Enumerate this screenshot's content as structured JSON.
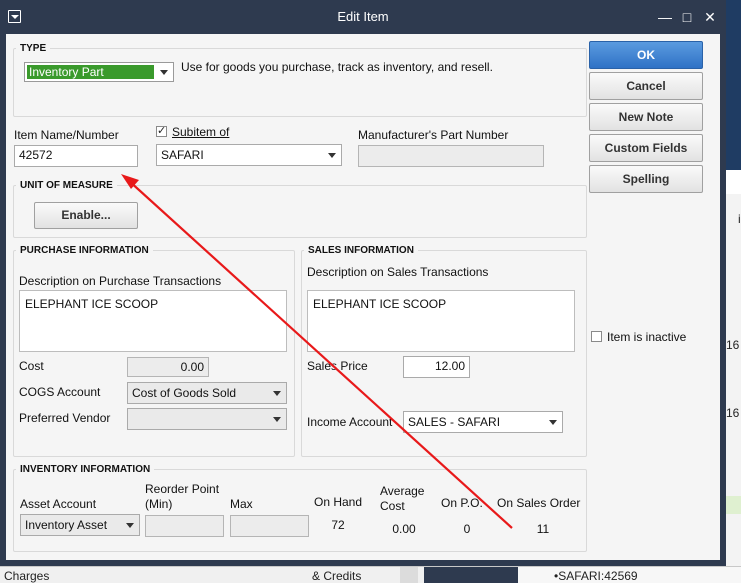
{
  "background": {
    "left_text": "Charges",
    "mid_text": "& Credits",
    "right_item": "•SAFARI:42569",
    "right_digits": [
      "16",
      "16"
    ],
    "right_letter": "i"
  },
  "window": {
    "title": "Edit Item",
    "minimize": "—",
    "maximize": "□",
    "close": "✕"
  },
  "type_section": {
    "legend": "TYPE",
    "selected": "Inventory Part",
    "description": "Use for goods you purchase, track as inventory, and resell."
  },
  "item": {
    "name_label": "Item Name/Number",
    "name_value": "42572",
    "subitem_label": "Subitem of",
    "subitem_checked": true,
    "subitem_value": "SAFARI",
    "mpn_label": "Manufacturer's Part Number",
    "mpn_value": ""
  },
  "uom": {
    "legend": "UNIT OF MEASURE",
    "enable_button": "Enable..."
  },
  "purchase": {
    "legend": "PURCHASE INFORMATION",
    "desc_label": "Description on Purchase Transactions",
    "desc_value": "ELEPHANT ICE SCOOP",
    "cost_label": "Cost",
    "cost_value": "0.00",
    "cogs_label": "COGS Account",
    "cogs_value": "Cost of Goods Sold",
    "vendor_label": "Preferred Vendor",
    "vendor_value": ""
  },
  "sales": {
    "legend": "SALES INFORMATION",
    "desc_label": "Description on Sales Transactions",
    "desc_value": "ELEPHANT ICE SCOOP",
    "price_label": "Sales Price",
    "price_value": "12.00",
    "income_label": "Income Account",
    "income_value": "SALES - SAFARI"
  },
  "inventory": {
    "legend": "INVENTORY INFORMATION",
    "asset_label": "Asset Account",
    "asset_value": "Inventory Asset",
    "reorder_label_1": "Reorder Point",
    "reorder_label_2": "(Min)",
    "max_label": "Max",
    "on_hand_label": "On Hand",
    "on_hand_value": "72",
    "avg_cost_label_1": "Average",
    "avg_cost_label_2": "Cost",
    "avg_cost_value": "0.00",
    "on_po_label": "On P.O.",
    "on_po_value": "0",
    "on_so_label": "On Sales Order",
    "on_so_value": "11"
  },
  "buttons": {
    "ok": "OK",
    "cancel": "Cancel",
    "new_note": "New Note",
    "custom_fields": "Custom Fields",
    "spelling": "Spelling"
  },
  "inactive": {
    "label": "Item is inactive",
    "checked": false
  },
  "colors": {
    "title_bar": "#2e3a4f",
    "type_highlight": "#3a9a2c",
    "ok_button": "#2f72c6",
    "annotation_arrow": "#e8191a"
  }
}
